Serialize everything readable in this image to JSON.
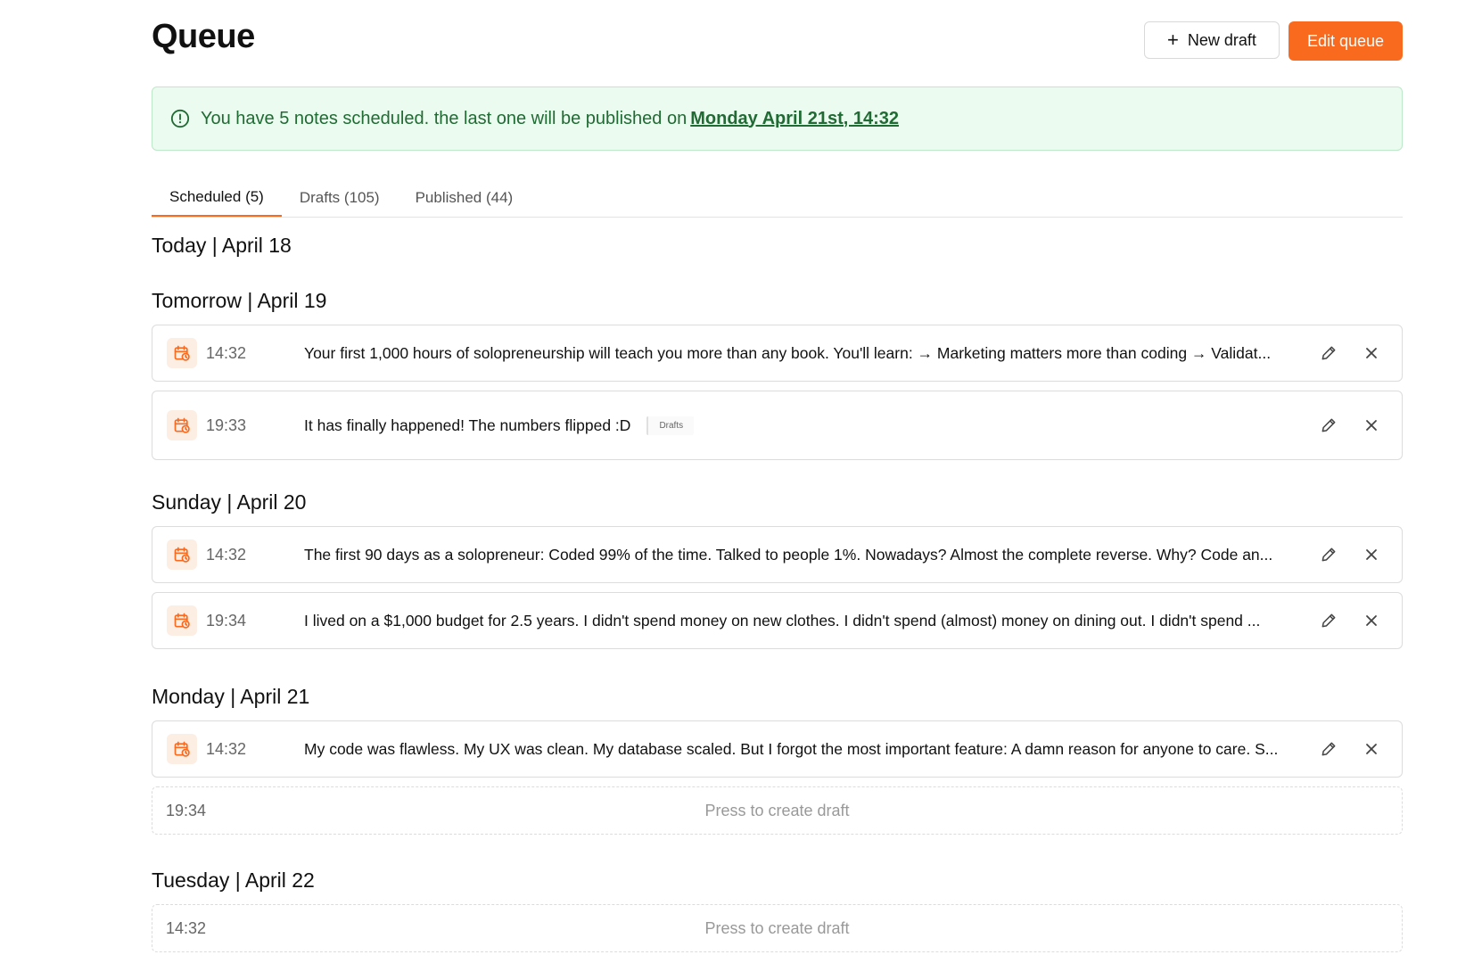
{
  "header": {
    "title": "Queue",
    "new_draft_label": "New draft",
    "edit_queue_label": "Edit queue"
  },
  "banner": {
    "message": "You have 5 notes scheduled. the last one will be published on",
    "date_link": "Monday April 21st, 14:32"
  },
  "tabs": [
    {
      "label": "Scheduled (5)",
      "active": true
    },
    {
      "label": "Drafts (105)",
      "active": false
    },
    {
      "label": "Published (44)",
      "active": false
    }
  ],
  "days": {
    "today": "Today | April 18",
    "tomorrow": "Tomorrow | April 19",
    "sunday": "Sunday | April 20",
    "monday": "Monday | April 21",
    "tuesday": "Tuesday | April 22"
  },
  "posts": [
    {
      "time": "14:32",
      "text": "Your first 1,000 hours of solopreneurship will teach you more than any book. You'll learn: → Marketing matters more than coding → Validat..."
    },
    {
      "time": "19:33",
      "text": "It has finally happened! The numbers flipped :D",
      "chip": "Drafts"
    },
    {
      "time": "14:32",
      "text": "The first 90 days as a solopreneur: Coded 99% of the time. Talked to people 1%. Nowadays? Almost the complete reverse. Why? Code an..."
    },
    {
      "time": "19:34",
      "text": "I lived on a $1,000 budget for 2.5 years. I didn't spend money on new clothes. I didn't spend (almost) money on dining out. I didn't spend ..."
    },
    {
      "time": "14:32",
      "text": "My code was flawless. My UX was clean. My database scaled. But I forgot the most important feature: A damn reason for anyone to care. S..."
    }
  ],
  "empty_slots": [
    {
      "time": "19:34",
      "cta": "Press to create draft"
    },
    {
      "time": "14:32",
      "cta": "Press to create draft"
    }
  ],
  "colors": {
    "accent": "#fa6a1e",
    "banner_bg": "#ecfbf0",
    "banner_text": "#1f6b33"
  }
}
